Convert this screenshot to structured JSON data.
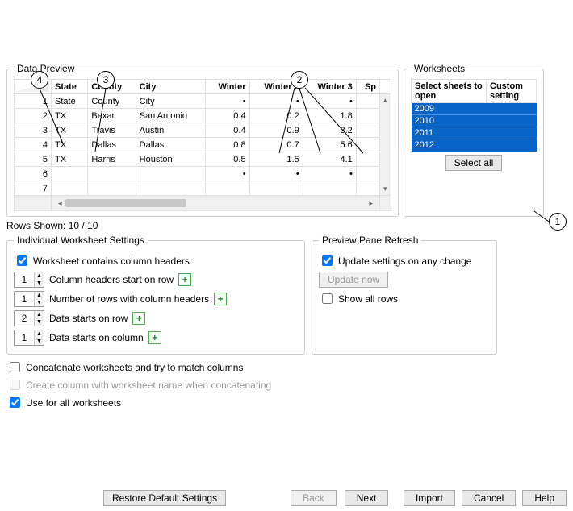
{
  "callouts": {
    "c1": "1",
    "c2": "2",
    "c3": "3",
    "c4": "4"
  },
  "dataPreview": {
    "legend": "Data Preview",
    "headers": [
      "State",
      "County",
      "City",
      "Winter",
      "Winter 2",
      "Winter 3",
      "Sp"
    ],
    "rows": [
      {
        "n": "1",
        "cells": [
          "State",
          "County",
          "City",
          "•",
          "•",
          "•",
          ""
        ]
      },
      {
        "n": "2",
        "cells": [
          "TX",
          "Bexar",
          "San Antonio",
          "0.4",
          "0.2",
          "1.8",
          ""
        ]
      },
      {
        "n": "3",
        "cells": [
          "TX",
          "Travis",
          "Austin",
          "0.4",
          "0.9",
          "3.2",
          ""
        ]
      },
      {
        "n": "4",
        "cells": [
          "TX",
          "Dallas",
          "Dallas",
          "0.8",
          "0.7",
          "5.6",
          ""
        ]
      },
      {
        "n": "5",
        "cells": [
          "TX",
          "Harris",
          "Houston",
          "0.5",
          "1.5",
          "4.1",
          ""
        ]
      },
      {
        "n": "6",
        "cells": [
          "",
          "",
          "",
          "•",
          "•",
          "•",
          ""
        ]
      },
      {
        "n": "7",
        "cells": [
          "",
          "",
          "",
          "",
          "",
          "",
          ""
        ]
      }
    ]
  },
  "rowsShown": "Rows Shown: 10 / 10",
  "worksheets": {
    "legend": "Worksheets",
    "col1": "Select sheets to open",
    "col2": "Custom setting",
    "items": [
      "2009",
      "2010",
      "2011",
      "2012"
    ],
    "selectAll": "Select all"
  },
  "iws": {
    "legend": "Individual Worksheet Settings",
    "containsHeaders": "Worksheet contains column headers",
    "s1": {
      "val": "1",
      "label": "Column headers start on row"
    },
    "s2": {
      "val": "1",
      "label": "Number of rows with column headers"
    },
    "s3": {
      "val": "2",
      "label": "Data starts on row"
    },
    "s4": {
      "val": "1",
      "label": "Data starts on column"
    }
  },
  "ppr": {
    "legend": "Preview Pane Refresh",
    "updateOnChange": "Update settings on any change",
    "updateNow": "Update now",
    "showAll": "Show all rows"
  },
  "opts": {
    "concat": "Concatenate worksheets and try to match columns",
    "createCol": "Create column with worksheet name when concatenating",
    "useAll": "Use for all worksheets"
  },
  "buttons": {
    "restore": "Restore Default Settings",
    "back": "Back",
    "next": "Next",
    "import": "Import",
    "cancel": "Cancel",
    "help": "Help"
  }
}
